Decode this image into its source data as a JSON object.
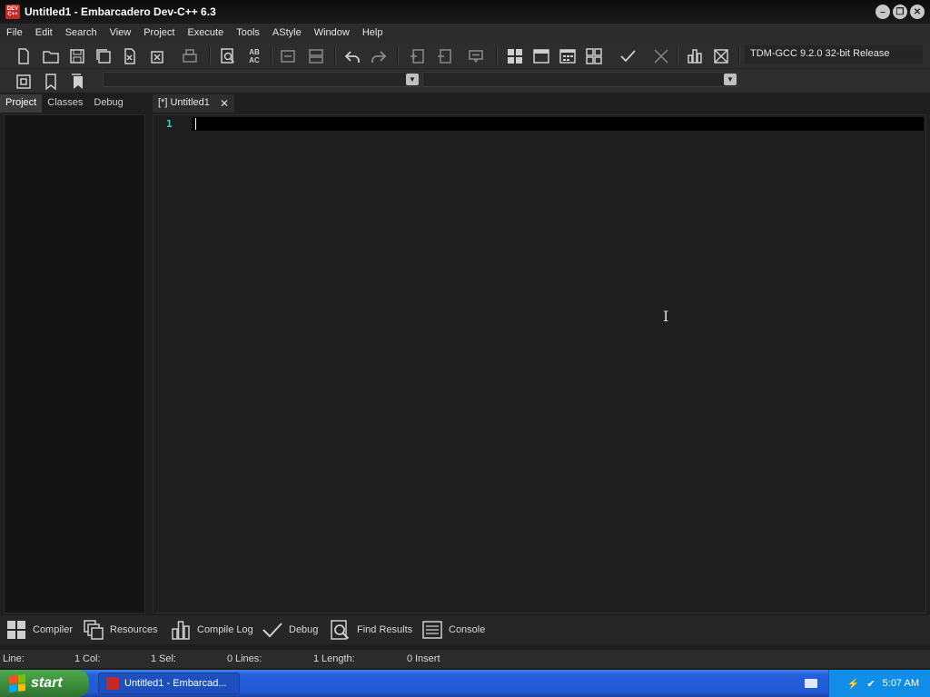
{
  "window": {
    "title": "Untitled1 - Embarcadero Dev-C++ 6.3",
    "app_icon_text": "DEV C++",
    "controls": [
      "minimize",
      "restore",
      "close"
    ]
  },
  "menubar": {
    "items": [
      "File",
      "Edit",
      "Search",
      "View",
      "Project",
      "Execute",
      "Tools",
      "AStyle",
      "Window",
      "Help"
    ]
  },
  "toolbar": {
    "compiler_selected": "TDM-GCC 9.2.0 32-bit Release",
    "replace_icon_text": "AB AC"
  },
  "left_panel": {
    "tabs": [
      "Project",
      "Classes",
      "Debug"
    ],
    "active_tab": "Project"
  },
  "editor": {
    "tabs": [
      {
        "label": "[*] Untitled1",
        "active": true
      }
    ],
    "line_numbers": [
      "1"
    ]
  },
  "bottom_tabs": [
    "Compiler",
    "Resources",
    "Compile Log",
    "Debug",
    "Find Results",
    "Console"
  ],
  "statusbar": {
    "line_label": "Line:",
    "line_value": "1",
    "col_label": "Col:",
    "col_value": "1",
    "sel_label": "Sel:",
    "sel_value": "0",
    "lines_label": "Lines:",
    "lines_value": "1",
    "length_label": "Length:",
    "length_value": "0",
    "mode": "Insert"
  },
  "taskbar": {
    "start_label": "start",
    "task_label": "Untitled1 - Embarcad...",
    "clock": "5:07 AM"
  },
  "colors": {
    "line_number": "#4bc6c9",
    "titlebar": "#0c0c0c",
    "editor_bg": "#1e1e1e",
    "taskbar": "#245edb",
    "start_button": "#3b8b3b"
  }
}
